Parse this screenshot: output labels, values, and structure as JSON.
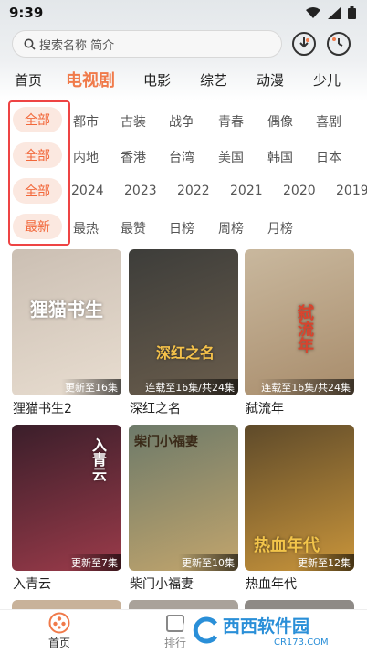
{
  "status": {
    "time": "9:39"
  },
  "search": {
    "placeholder": "搜索名称 简介"
  },
  "tabs": [
    "首页",
    "电视剧",
    "电影",
    "综艺",
    "动漫",
    "少儿"
  ],
  "filters": {
    "row1": {
      "selected": "全部",
      "options": [
        "都市",
        "古装",
        "战争",
        "青春",
        "偶像",
        "喜剧"
      ]
    },
    "row2": {
      "selected": "全部",
      "options": [
        "内地",
        "香港",
        "台湾",
        "美国",
        "韩国",
        "日本"
      ]
    },
    "row3": {
      "selected": "全部",
      "options": [
        "2024",
        "2023",
        "2022",
        "2021",
        "2020",
        "2019"
      ]
    },
    "row4": {
      "selected": "最新",
      "options": [
        "最热",
        "最赞",
        "日榜",
        "周榜",
        "月榜"
      ]
    }
  },
  "cards": [
    {
      "title": "狸猫书生2",
      "badge": "更新至16集",
      "poster_text": "狸猫书生",
      "colors": [
        "#cbbfb3",
        "#e8ddd0"
      ]
    },
    {
      "title": "深红之名",
      "badge": "连载至16集/共24集",
      "poster_text": "深红之名",
      "colors": [
        "#3d3d3a",
        "#6a5d4c"
      ]
    },
    {
      "title": "弑流年",
      "badge": "连载至16集/共24集",
      "poster_text": "弑流年",
      "colors": [
        "#c9b89e",
        "#a88c6b"
      ]
    },
    {
      "title": "入青云",
      "badge": "更新至7集",
      "poster_text": "入青云",
      "colors": [
        "#3a1e2a",
        "#9b3b4a"
      ]
    },
    {
      "title": "柴门小福妻",
      "badge": "更新至10集",
      "poster_text": "柴门小福妻",
      "colors": [
        "#6d7a6a",
        "#c2a56c"
      ]
    },
    {
      "title": "热血年代",
      "badge": "更新至12集",
      "poster_text": "热血年代",
      "colors": [
        "#5e4a2a",
        "#c9953b"
      ]
    }
  ],
  "bottom_nav": {
    "home": "首页",
    "rank": "排行"
  },
  "watermark": {
    "name": "西西软件园",
    "url": "CR173.COM"
  },
  "colors": {
    "accent": "#f07a4a",
    "chip_bg": "#fbe8e0",
    "highlight_box": "#e44444"
  }
}
